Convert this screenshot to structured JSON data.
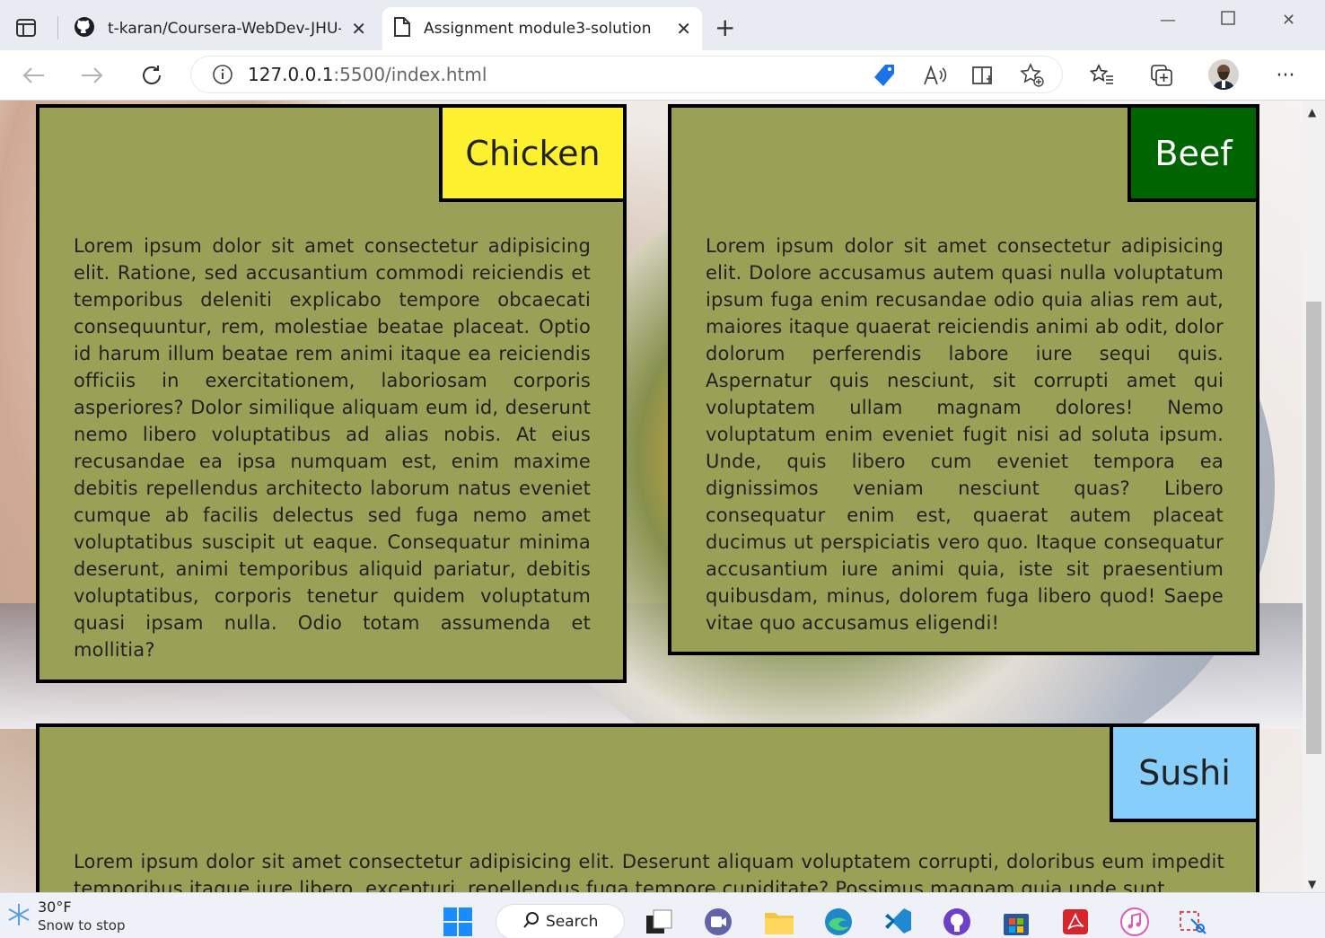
{
  "browser": {
    "tabs": [
      {
        "title": "t-karan/Coursera-WebDev-JHU-A",
        "icon": "github-icon",
        "active": false
      },
      {
        "title": "Assignment module3-solution",
        "icon": "page-icon",
        "active": true
      }
    ],
    "address": {
      "host": "127.0.0.1",
      "rest": ":5500/index.html"
    }
  },
  "page": {
    "sections": [
      {
        "label": "Chicken",
        "label_bg": "#fdf02e",
        "label_color": "#222222",
        "text": "Lorem ipsum dolor sit amet consectetur adipisicing elit. Ratione, sed accusantium commodi reiciendis et temporibus deleniti explicabo tempore obcaecati consequuntur, rem, molestiae beatae placeat. Optio id harum illum beatae rem animi itaque ea reiciendis officiis in exercitationem, laboriosam corporis asperiores? Dolor similique aliquam eum id, deserunt nemo libero voluptatibus ad alias nobis. At eius recusandae ea ipsa numquam est, enim maxime debitis repellendus architecto laborum natus eveniet cumque ab facilis delectus sed fuga nemo amet voluptatibus suscipit ut eaque. Consequatur minima deserunt, animi temporibus aliquid pariatur, debitis voluptatibus, corporis tenetur quidem voluptatum quasi ipsam nulla. Odio totam assumenda et mollitia?"
      },
      {
        "label": "Beef",
        "label_bg": "#006400",
        "label_color": "#ffffff",
        "text": "Lorem ipsum dolor sit amet consectetur adipisicing elit. Dolore accusamus autem quasi nulla voluptatum ipsum fuga enim recusandae odio quia alias rem aut, maiores itaque quaerat reiciendis animi ab odit, dolor dolorum perferendis labore iure sequi quis. Aspernatur quis nesciunt, sit corrupti amet qui voluptatem ullam magnam dolores! Nemo voluptatum enim eveniet fugit nisi ad soluta ipsum. Unde, quis libero cum eveniet tempora ea dignissimos veniam nesciunt quas? Libero consequatur enim est, quaerat autem placeat ducimus ut perspiciatis vero quo. Itaque consequatur accusantium iure animi quia, iste sit praesentium quibusdam, minus, dolorem fuga libero quod! Saepe vitae quo accusamus eligendi!"
      },
      {
        "label": "Sushi",
        "label_bg": "#87cefa",
        "label_color": "#222222",
        "text": "Lorem ipsum dolor sit amet consectetur adipisicing elit. Deserunt aliquam voluptatem corrupti, doloribus eum impedit temporibus itaque iure libero, excepturi, repellendus fuga tempore cupiditate? Possimus magnam quia unde sunt"
      }
    ],
    "card_bg": "#9aa157"
  },
  "taskbar": {
    "weather": {
      "temp": "30°F",
      "desc": "Snow to stop"
    },
    "search_label": "Search"
  }
}
